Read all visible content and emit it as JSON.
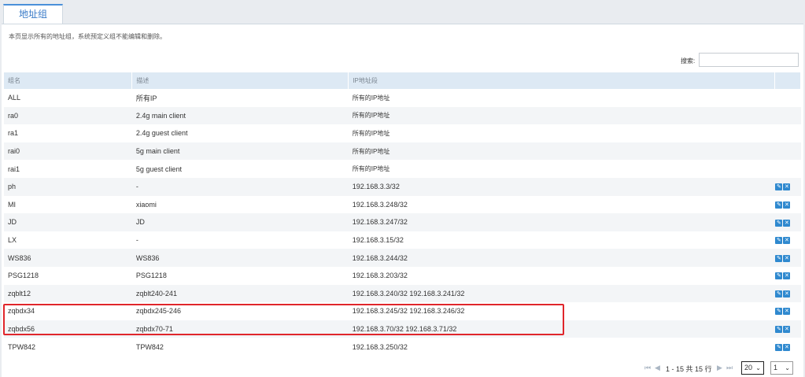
{
  "tab": {
    "label": "地址组"
  },
  "description": "本页显示所有的地址组，系统预定义组不能编辑和删除。",
  "search": {
    "label": "搜索:",
    "value": ""
  },
  "table": {
    "headers": [
      "组名",
      "描述",
      "IP地址段"
    ],
    "rows": [
      {
        "name": "ALL",
        "desc": "所有IP",
        "ip": "所有的IP地址",
        "editable": false
      },
      {
        "name": "ra0",
        "desc": "2.4g main client",
        "ip": "所有的IP地址",
        "editable": false
      },
      {
        "name": "ra1",
        "desc": "2.4g guest client",
        "ip": "所有的IP地址",
        "editable": false
      },
      {
        "name": "rai0",
        "desc": "5g main client",
        "ip": "所有的IP地址",
        "editable": false
      },
      {
        "name": "rai1",
        "desc": "5g guest client",
        "ip": "所有的IP地址",
        "editable": false
      },
      {
        "name": "ph",
        "desc": "-",
        "ip": "192.168.3.3/32",
        "editable": true
      },
      {
        "name": "MI",
        "desc": "xiaomi",
        "ip": "192.168.3.248/32",
        "editable": true
      },
      {
        "name": "JD",
        "desc": "JD",
        "ip": "192.168.3.247/32",
        "editable": true
      },
      {
        "name": "LX",
        "desc": "-",
        "ip": "192.168.3.15/32",
        "editable": true
      },
      {
        "name": "WS836",
        "desc": "WS836",
        "ip": "192.168.3.244/32",
        "editable": true
      },
      {
        "name": "PSG1218",
        "desc": "PSG1218",
        "ip": "192.168.3.203/32",
        "editable": true
      },
      {
        "name": "zqblt12",
        "desc": "zqblt240-241",
        "ip": "192.168.3.240/32 192.168.3.241/32",
        "editable": true
      },
      {
        "name": "zqbdx34",
        "desc": "zqbdx245-246",
        "ip": "192.168.3.245/32 192.168.3.246/32",
        "editable": true
      },
      {
        "name": "zqbdx56",
        "desc": "zqbdx70-71",
        "ip": "192.168.3.70/32 192.168.3.71/32",
        "editable": true
      },
      {
        "name": "TPW842",
        "desc": "TPW842",
        "ip": "192.168.3.250/32",
        "editable": true
      }
    ]
  },
  "icons": {
    "edit": "pencil-icon",
    "delete": "close-icon",
    "first": "first-page-icon",
    "prev": "prev-page-icon",
    "next": "next-page-icon",
    "last": "last-page-icon"
  },
  "pager": {
    "summary": "1 - 15 共 15 行",
    "page_size": "20",
    "page": "1"
  },
  "colors": {
    "accent": "#2f89cf",
    "highlight": "#e0262b",
    "header_bg": "#dde9f4"
  }
}
